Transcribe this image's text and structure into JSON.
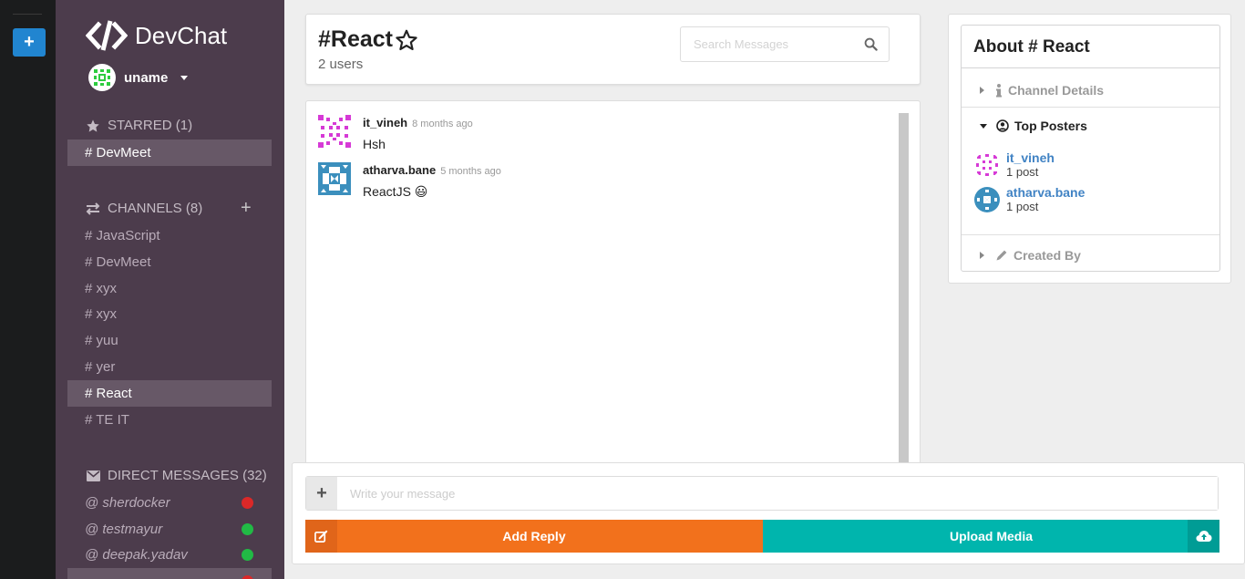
{
  "app": {
    "brand": "DevChat",
    "user": "uname"
  },
  "sidebar": {
    "starred": {
      "title": "STARRED (1)",
      "items": [
        {
          "label": "# DevMeet"
        }
      ]
    },
    "channels": {
      "title": "CHANNELS (8)",
      "items": [
        {
          "label": "# JavaScript"
        },
        {
          "label": "# DevMeet"
        },
        {
          "label": "# xyx"
        },
        {
          "label": "# xyx"
        },
        {
          "label": "# yuu"
        },
        {
          "label": "# yer"
        },
        {
          "label": "# React"
        },
        {
          "label": "# TE IT"
        }
      ],
      "active_index": 6
    },
    "direct_messages": {
      "title": "DIRECT MESSAGES (32)",
      "items": [
        {
          "label": "@ sherdocker",
          "status_color": "#db2828"
        },
        {
          "label": "@ testmayur",
          "status_color": "#21ba45"
        },
        {
          "label": "@ deepak.yadav",
          "status_color": "#21ba45"
        }
      ]
    }
  },
  "channel": {
    "title": "#React",
    "users": "2 users",
    "search_placeholder": "Search Messages"
  },
  "messages": [
    {
      "author": "it_vineh",
      "time": "8 months ago",
      "text": "Hsh"
    },
    {
      "author": "atharva.bane",
      "time": "5 months ago",
      "text": "ReactJS 😃"
    }
  ],
  "compose": {
    "placeholder": "Write your message",
    "reply_label": "Add Reply",
    "upload_label": "Upload Media"
  },
  "about": {
    "title": "About # React",
    "channel_details": "Channel Details",
    "top_posters": "Top Posters",
    "created_by": "Created By",
    "posters": [
      {
        "name": "it_vineh",
        "count": "1 post"
      },
      {
        "name": "atharva.bane",
        "count": "1 post"
      }
    ]
  },
  "colors": {
    "sidebar_bg": "#4c3c4c",
    "primary": "#2185d0",
    "reply": "#f2711c",
    "upload": "#00b5ad"
  }
}
